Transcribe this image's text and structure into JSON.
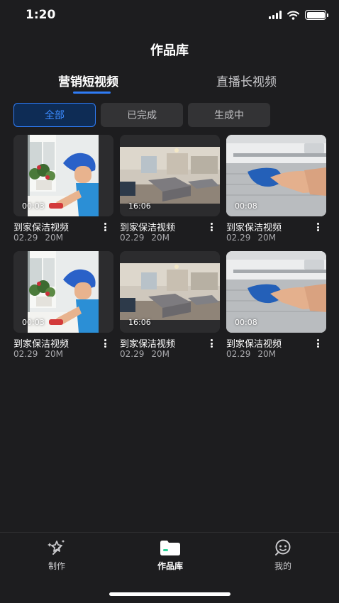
{
  "status": {
    "time": "1:20"
  },
  "page_title": "作品库",
  "tabs": [
    {
      "label": "营销短视频",
      "active": true
    },
    {
      "label": "直播长视频",
      "active": false
    }
  ],
  "filters": [
    {
      "label": "全部",
      "active": true
    },
    {
      "label": "已完成",
      "active": false
    },
    {
      "label": "生成中",
      "active": false
    }
  ],
  "videos": [
    {
      "title": "到家保洁视频",
      "date": "02.29",
      "size": "20M",
      "duration": "00:03",
      "scene": "worker"
    },
    {
      "title": "到家保洁视频",
      "date": "02.29",
      "size": "20M",
      "duration": "16:06",
      "scene": "bedroom"
    },
    {
      "title": "到家保洁视频",
      "date": "02.29",
      "size": "20M",
      "duration": "00:08",
      "scene": "aircon"
    },
    {
      "title": "到家保洁视频",
      "date": "02.29",
      "size": "20M",
      "duration": "00:03",
      "scene": "worker"
    },
    {
      "title": "到家保洁视频",
      "date": "02.29",
      "size": "20M",
      "duration": "16:06",
      "scene": "bedroom"
    },
    {
      "title": "到家保洁视频",
      "date": "02.29",
      "size": "20M",
      "duration": "00:08",
      "scene": "aircon"
    }
  ],
  "nav": [
    {
      "label": "制作",
      "icon": "magic-wand-icon"
    },
    {
      "label": "作品库",
      "icon": "folder-icon",
      "active": true
    },
    {
      "label": "我的",
      "icon": "user-icon"
    }
  ],
  "colors": {
    "accent": "#2f7cf6",
    "background": "#1d1d1f"
  }
}
